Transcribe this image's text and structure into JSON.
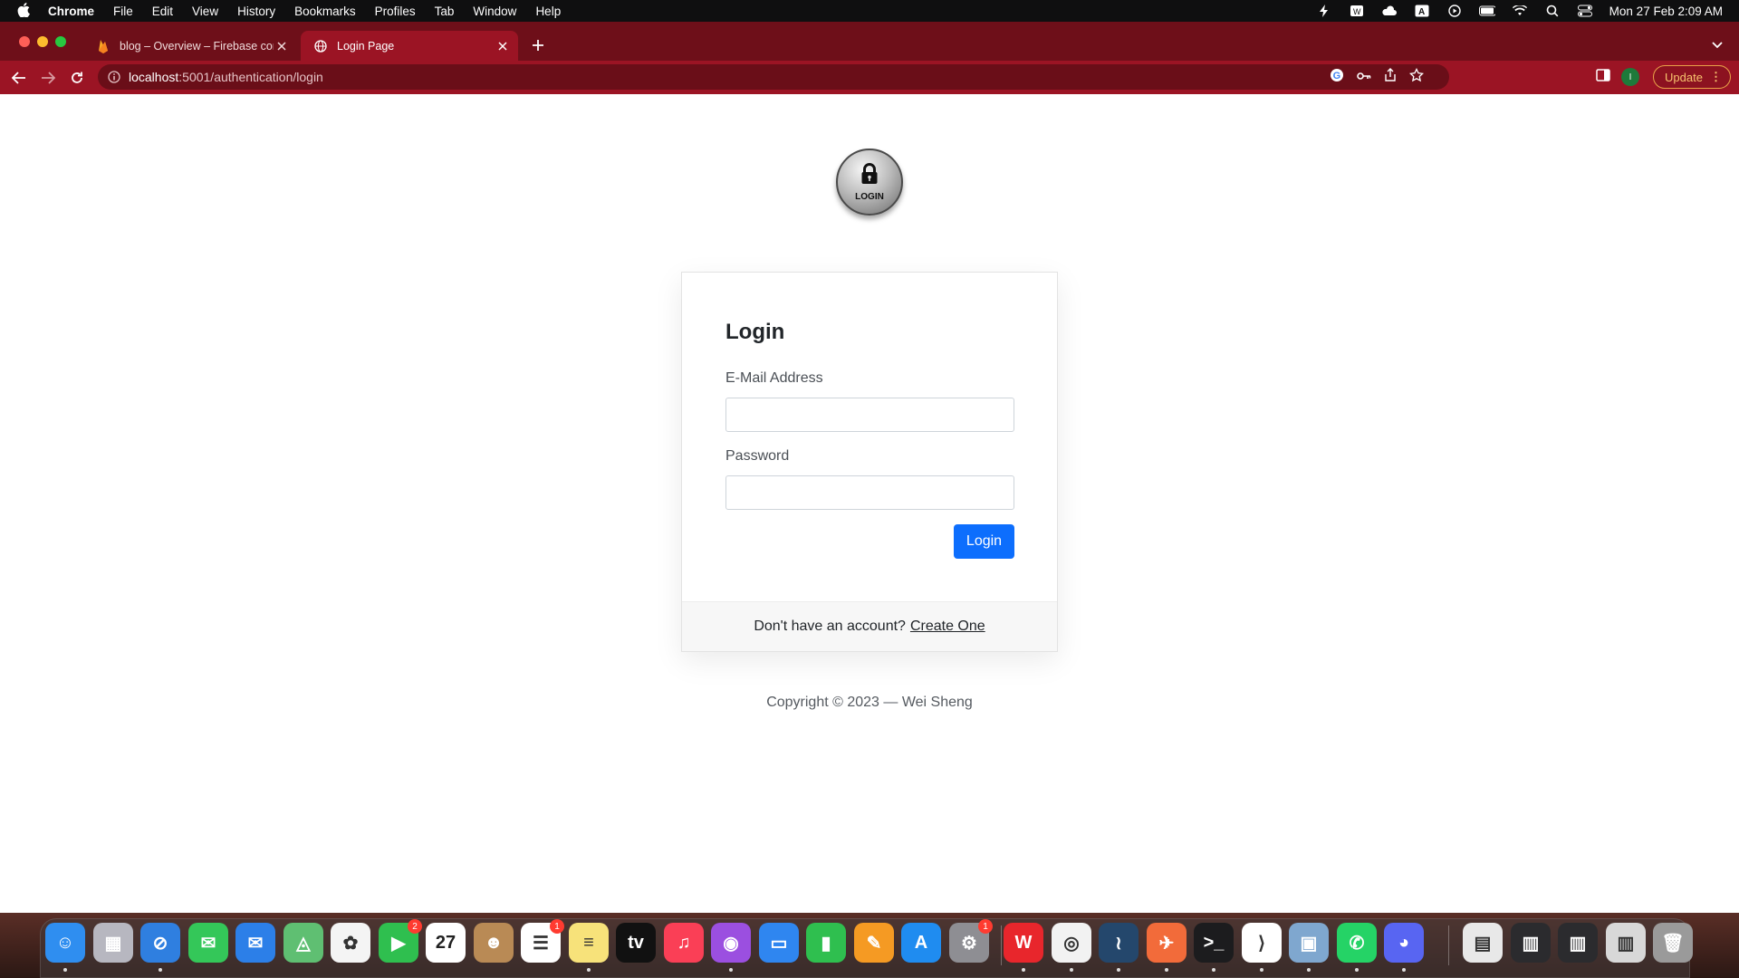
{
  "menubar": {
    "app": "Chrome",
    "items": [
      "File",
      "Edit",
      "View",
      "History",
      "Bookmarks",
      "Profiles",
      "Tab",
      "Window",
      "Help"
    ],
    "clock": "Mon 27 Feb  2:09 AM"
  },
  "tabs": [
    {
      "title": "blog – Overview – Firebase console",
      "favicon": "firebase-icon",
      "active": false
    },
    {
      "title": "Login Page",
      "favicon": "globe-icon",
      "active": true
    }
  ],
  "toolbar": {
    "url_host": "localhost",
    "url_path": ":5001/authentication/login",
    "profile_initial": "I",
    "update_label": "Update"
  },
  "page": {
    "logo_text": "LOGIN",
    "heading": "Login",
    "email_label": "E-Mail Address",
    "email_value": "",
    "password_label": "Password",
    "password_value": "",
    "login_button": "Login",
    "footer_text": "Don't have an account?",
    "footer_link": "Create One",
    "copyright": "Copyright © 2023 — Wei Sheng"
  },
  "dock": {
    "apps": [
      {
        "name": "Finder",
        "icon": "finder-icon",
        "color": "#2f8ef0",
        "glyph": "☺",
        "running": true
      },
      {
        "name": "Launchpad",
        "icon": "launchpad-icon",
        "color": "#b7b7c0",
        "glyph": "▦",
        "running": false
      },
      {
        "name": "Safari",
        "icon": "safari-icon",
        "color": "#2f7fe0",
        "glyph": "⊘",
        "running": true
      },
      {
        "name": "Messages",
        "icon": "messages-icon",
        "color": "#34c759",
        "glyph": "✉",
        "running": false
      },
      {
        "name": "Mail",
        "icon": "mail-icon",
        "color": "#2c7fe8",
        "glyph": "✉",
        "running": false
      },
      {
        "name": "Maps",
        "icon": "maps-icon",
        "color": "#5fbf72",
        "glyph": "◬",
        "running": false
      },
      {
        "name": "Photos",
        "icon": "photos-icon",
        "color": "#f4f4f4",
        "glyph": "✿",
        "running": false
      },
      {
        "name": "FaceTime",
        "icon": "facetime-icon",
        "color": "#2fbf4f",
        "glyph": "▶",
        "running": false,
        "badge": "2"
      },
      {
        "name": "Calendar",
        "icon": "calendar-icon",
        "color": "#ffffff",
        "glyph": "27",
        "running": false
      },
      {
        "name": "Contacts",
        "icon": "contacts-icon",
        "color": "#b98a55",
        "glyph": "☻",
        "running": false
      },
      {
        "name": "Reminders",
        "icon": "reminders-icon",
        "color": "#ffffff",
        "glyph": "☰",
        "running": false,
        "badge": "1"
      },
      {
        "name": "Notes",
        "icon": "notes-icon",
        "color": "#f7e27a",
        "glyph": "≡",
        "running": true
      },
      {
        "name": "TV",
        "icon": "tv-icon",
        "color": "#111111",
        "glyph": "tv",
        "running": false
      },
      {
        "name": "Music",
        "icon": "music-icon",
        "color": "#fa3f56",
        "glyph": "♫",
        "running": false
      },
      {
        "name": "Podcasts",
        "icon": "podcasts-icon",
        "color": "#9b4fe0",
        "glyph": "◉",
        "running": true
      },
      {
        "name": "Keynote",
        "icon": "keynote-icon",
        "color": "#2f86f0",
        "glyph": "▭",
        "running": false
      },
      {
        "name": "Numbers",
        "icon": "numbers-icon",
        "color": "#2fbf4f",
        "glyph": "▮",
        "running": false
      },
      {
        "name": "Pages",
        "icon": "pages-icon",
        "color": "#f59a23",
        "glyph": "✎",
        "running": false
      },
      {
        "name": "App Store",
        "icon": "app-store-icon",
        "color": "#1f8cf0",
        "glyph": "A",
        "running": false
      },
      {
        "name": "System Settings",
        "icon": "settings-icon",
        "color": "#8e8e93",
        "glyph": "⚙",
        "running": false,
        "badge": "1"
      },
      {
        "name": "WPS Office",
        "icon": "wps-icon",
        "color": "#e8262c",
        "glyph": "W",
        "running": true
      },
      {
        "name": "Chrome",
        "icon": "chrome-icon",
        "color": "#f2f2f2",
        "glyph": "◎",
        "running": true
      },
      {
        "name": "MySQL Workbench",
        "icon": "mysql-icon",
        "color": "#24476c",
        "glyph": "≀",
        "running": true
      },
      {
        "name": "Postman",
        "icon": "postman-icon",
        "color": "#f26b3a",
        "glyph": "✈",
        "running": true
      },
      {
        "name": "Terminal",
        "icon": "terminal-icon",
        "color": "#1c1c1e",
        "glyph": ">_",
        "running": true
      },
      {
        "name": "VS Code",
        "icon": "vscode-icon",
        "color": "#ffffff",
        "glyph": "⟩",
        "running": true
      },
      {
        "name": "Preview",
        "icon": "preview-icon",
        "color": "#7fa7cf",
        "glyph": "▣",
        "running": true
      },
      {
        "name": "WhatsApp",
        "icon": "whatsapp-icon",
        "color": "#25d366",
        "glyph": "✆",
        "running": true
      },
      {
        "name": "Discord",
        "icon": "discord-icon",
        "color": "#5865f2",
        "glyph": "◕",
        "running": true
      }
    ],
    "others": [
      {
        "name": "Downloads stack",
        "icon": "stack-icon",
        "color": "#e8e8e8",
        "glyph": "▤"
      },
      {
        "name": "Recent window",
        "icon": "window-thumbnail-icon",
        "color": "#2b2b2e",
        "glyph": "▥"
      },
      {
        "name": "Recent window",
        "icon": "window-thumbnail-icon",
        "color": "#2b2b2e",
        "glyph": "▥"
      },
      {
        "name": "Recent window",
        "icon": "window-thumbnail-icon",
        "color": "#d8d8d8",
        "glyph": "▥"
      },
      {
        "name": "Trash",
        "icon": "trash-icon",
        "color": "#9a9a9a",
        "glyph": "🗑"
      }
    ]
  }
}
